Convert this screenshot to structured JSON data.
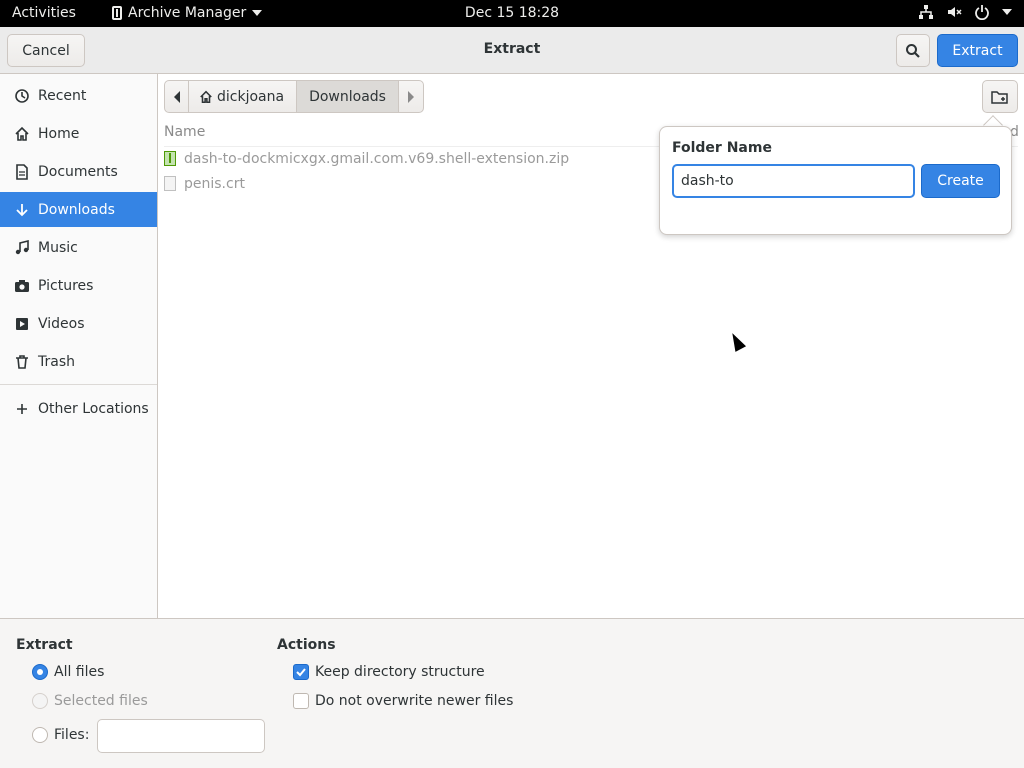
{
  "topbar": {
    "activities": "Activities",
    "app_name": "Archive Manager",
    "clock": "Dec 15  18:28"
  },
  "headerbar": {
    "cancel_label": "Cancel",
    "title": "Extract",
    "extract_label": "Extract"
  },
  "sidebar": {
    "items": [
      {
        "label": "Recent",
        "icon": "clock-icon"
      },
      {
        "label": "Home",
        "icon": "home-icon"
      },
      {
        "label": "Documents",
        "icon": "document-icon"
      },
      {
        "label": "Downloads",
        "icon": "download-icon"
      },
      {
        "label": "Music",
        "icon": "music-icon"
      },
      {
        "label": "Pictures",
        "icon": "camera-icon"
      },
      {
        "label": "Videos",
        "icon": "video-icon"
      },
      {
        "label": "Trash",
        "icon": "trash-icon"
      }
    ],
    "other_locations": "Other Locations"
  },
  "pathbar": {
    "home_label": "dickjoana",
    "current": "Downloads"
  },
  "filelist": {
    "name_header": "Name",
    "modified_header_partial": "d",
    "files": [
      {
        "name": "dash-to-dockmicxgx.gmail.com.v69.shell-extension.zip",
        "type": "zip"
      },
      {
        "name": "penis.crt",
        "type": "file"
      }
    ]
  },
  "popover": {
    "label": "Folder Name",
    "value": "dash-to",
    "create_label": "Create"
  },
  "options": {
    "extract_title": "Extract",
    "all_files": "All files",
    "selected_files": "Selected files",
    "files_label": "Files:",
    "actions_title": "Actions",
    "keep_structure": "Keep directory structure",
    "no_overwrite": "Do not overwrite newer files"
  },
  "colors": {
    "accent": "#3584e4",
    "topbar_bg": "#000000"
  }
}
